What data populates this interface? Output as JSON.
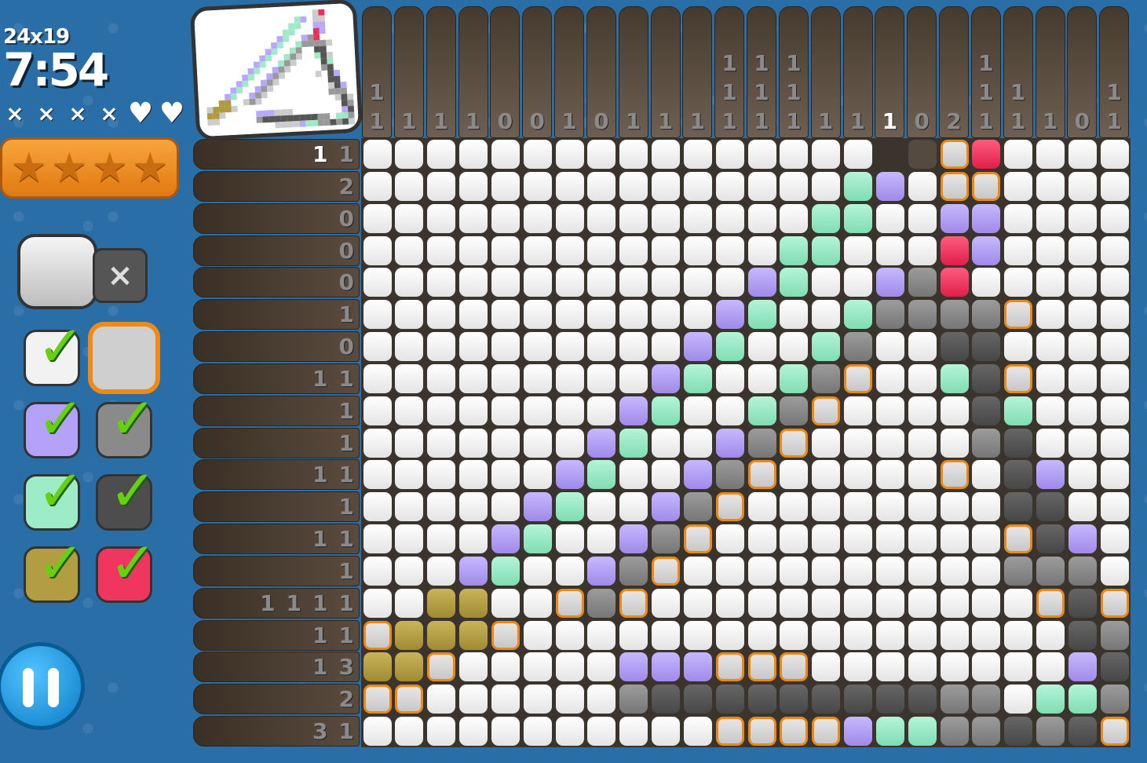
{
  "header": {
    "size_label": "24x19",
    "timer": "7:54"
  },
  "lives": [
    "×",
    "×",
    "×",
    "×",
    "♥",
    "♥"
  ],
  "stars": [
    "★",
    "★",
    "★",
    "★"
  ],
  "mode_x_symbol": "×",
  "palette": [
    {
      "name": "white",
      "color": "#f2f2f2",
      "done": true,
      "check": "✓"
    },
    {
      "name": "gray-selected",
      "color": "#cfcfcf",
      "done": false,
      "selected": true,
      "check": ""
    },
    {
      "name": "violet",
      "color": "#b3a2f7",
      "done": true,
      "check": "✓"
    },
    {
      "name": "gray",
      "color": "#8a8a8a",
      "done": true,
      "check": "✓"
    },
    {
      "name": "teal",
      "color": "#9eebc8",
      "done": true,
      "check": "✓"
    },
    {
      "name": "dark",
      "color": "#4d4d4d",
      "done": true,
      "check": "✓"
    },
    {
      "name": "olive",
      "color": "#b29d43",
      "done": true,
      "check": "✓"
    },
    {
      "name": "red",
      "color": "#f0355f",
      "done": true,
      "check": "✓"
    }
  ],
  "column_clues": [
    [
      "1",
      "1"
    ],
    [
      "1"
    ],
    [
      "1"
    ],
    [
      "1"
    ],
    [
      "0"
    ],
    [
      "0"
    ],
    [
      "1"
    ],
    [
      "0"
    ],
    [
      "1"
    ],
    [
      "1"
    ],
    [
      "1"
    ],
    [
      "1",
      "1",
      "1"
    ],
    [
      "1",
      "1",
      "1"
    ],
    [
      "1",
      "1",
      "1"
    ],
    [
      "1"
    ],
    [
      "1"
    ],
    [
      "1"
    ],
    [
      "0"
    ],
    [
      "2"
    ],
    [
      "1",
      "1",
      "1"
    ],
    [
      "1",
      "1"
    ],
    [
      "1"
    ],
    [
      "0"
    ],
    [
      "1",
      "1"
    ]
  ],
  "highlight_col": 16,
  "row_clues": [
    [
      "1",
      "1"
    ],
    [
      "2"
    ],
    [
      "0"
    ],
    [
      "0"
    ],
    [
      "0"
    ],
    [
      "1"
    ],
    [
      "0"
    ],
    [
      "1",
      "1"
    ],
    [
      "1"
    ],
    [
      "1"
    ],
    [
      "1",
      "1"
    ],
    [
      "1"
    ],
    [
      "1",
      "1"
    ],
    [
      "1"
    ],
    [
      "1",
      "1",
      "1",
      "1"
    ],
    [
      "1",
      "1"
    ],
    [
      "1",
      "3"
    ],
    [
      "2"
    ],
    [
      "3",
      "1"
    ]
  ],
  "highlight_row": 0,
  "grid_rows": [
    "wwwwwwwwwwwwwwwwesmrwwww",
    "wwwwwwwwwwwwwwwtvwmmwwww",
    "wwwwwwwwwwwwwwttwwvvwwww",
    "wwwwwwwwwwwwwttwwwrvwwww",
    "wwwwwwwwwwwwvtwwvgrwwwww",
    "wwwwwwwwwwwvtwwtggggmwww",
    "wwwwwwwwwwvtwwtgwwddwwww",
    "wwwwwwwwwvtwwtgmwwtdmwww",
    "wwwwwwwwvtwwtgmwwwwdtwww",
    "wwwwwwwvtwwvgmwwwwwgdwww",
    "wwwwwwvtwwvgmwwwwwmwdvww",
    "wwwwwvtwwvgmwwwwwwwwddww",
    "wwwwvtwwvgmwwwwwwwwwmdvw",
    "wwwvtwwvgmwwwwwwwwwwgggw",
    "wwoowwmgmwwwwwwwwwwwwmdm",
    "mooomwwwwwwwwwwwwwwwwwdg",
    "oomwwwwwvvvmmmwwwwwwwwvd",
    "mmwwwwwwgdddddddddggwttg",
    "wwwwwwwwwwwmmmmvttggdgdm"
  ]
}
